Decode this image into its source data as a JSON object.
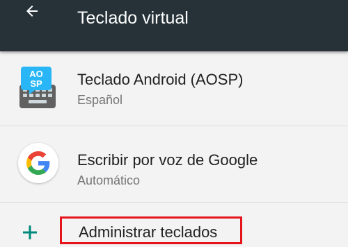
{
  "appbar": {
    "title": "Teclado virtual",
    "back_icon": "arrow-left-icon",
    "background": "#263238"
  },
  "keyboards": [
    {
      "name": "Teclado Android (AOSP)",
      "subtitle": "Español",
      "icon": "aosp-keyboard-icon",
      "icon_text": [
        "AO",
        "SP"
      ]
    },
    {
      "name": "Escribir por voz de Google",
      "subtitle": "Automático",
      "icon": "google-g-icon"
    }
  ],
  "manage": {
    "label": "Administrar teclados",
    "icon": "plus-icon",
    "accent": "#00897b",
    "highlight": "#e5141b"
  }
}
